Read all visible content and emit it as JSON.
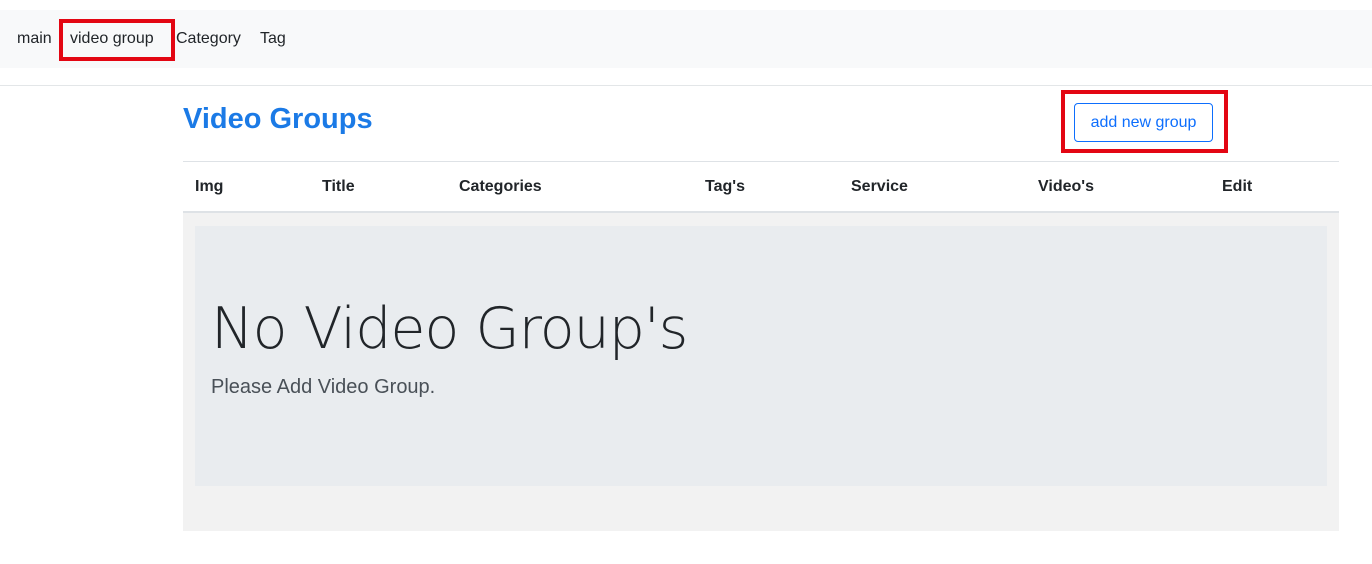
{
  "nav": {
    "items": [
      {
        "label": "main"
      },
      {
        "label": "video group"
      },
      {
        "label": "Category"
      },
      {
        "label": "Tag"
      }
    ]
  },
  "page": {
    "title": "Video Groups",
    "add_button_label": "add new group"
  },
  "table": {
    "headers": [
      "Img",
      "Title",
      "Categories",
      "Tag's",
      "Service",
      "Video's",
      "Edit"
    ]
  },
  "empty_state": {
    "title": "No Video Group's",
    "subtitle": "Please Add Video Group."
  },
  "colors": {
    "highlight": "#e30613",
    "title": "#1b7ae6",
    "button": "#0d6efd"
  }
}
